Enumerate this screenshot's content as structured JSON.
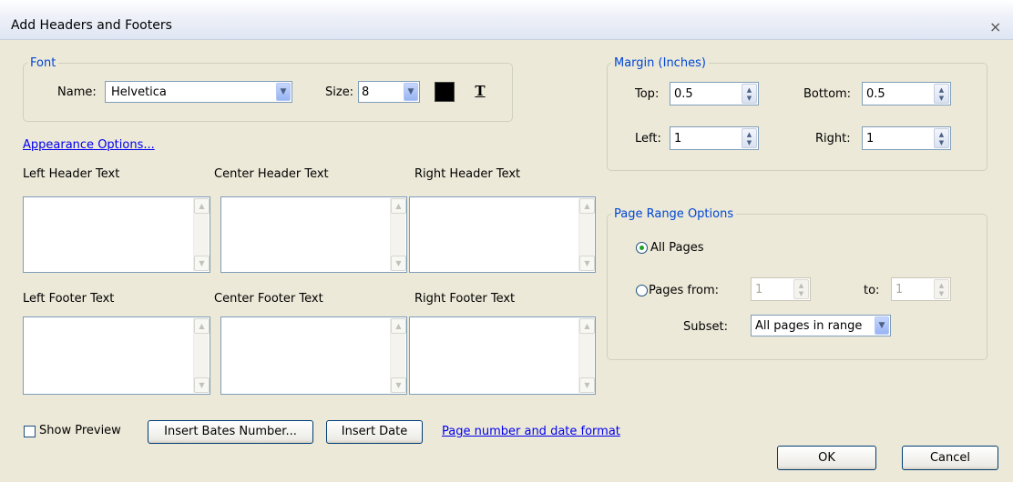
{
  "window": {
    "title": "Add Headers and Footers",
    "close_glyph": "×"
  },
  "font": {
    "group_label": "Font",
    "name_label": "Name:",
    "name_value": "Helvetica",
    "size_label": "Size:",
    "size_value": "8",
    "text_color": "#000000",
    "text_icon_glyph": "T"
  },
  "appearance_link": "Appearance Options...",
  "headers": {
    "left": "Left Header Text",
    "center": "Center Header Text",
    "right": "Right Header Text"
  },
  "footers": {
    "left": "Left Footer Text",
    "center": "Center Footer Text",
    "right": "Right Footer Text"
  },
  "margin": {
    "group_label": "Margin (Inches)",
    "top_label": "Top:",
    "top_value": "0.5",
    "bottom_label": "Bottom:",
    "bottom_value": "0.5",
    "left_label": "Left:",
    "left_value": "1",
    "right_label": "Right:",
    "right_value": "1"
  },
  "page_range": {
    "group_label": "Page Range Options",
    "all_pages_label": "All Pages",
    "all_pages_selected": true,
    "pages_from_label": "Pages from:",
    "from_value": "1",
    "to_label": "to:",
    "to_value": "1",
    "subset_label": "Subset:",
    "subset_value": "All pages in range"
  },
  "bottom": {
    "show_preview": "Show Preview",
    "show_preview_checked": false,
    "insert_bates": "Insert Bates Number...",
    "insert_date": "Insert Date",
    "format_link": "Page number and date format",
    "ok": "OK",
    "cancel": "Cancel"
  },
  "icons": {
    "dropdown_arrow": "▼",
    "spin_up": "▲",
    "spin_down": "▼"
  }
}
